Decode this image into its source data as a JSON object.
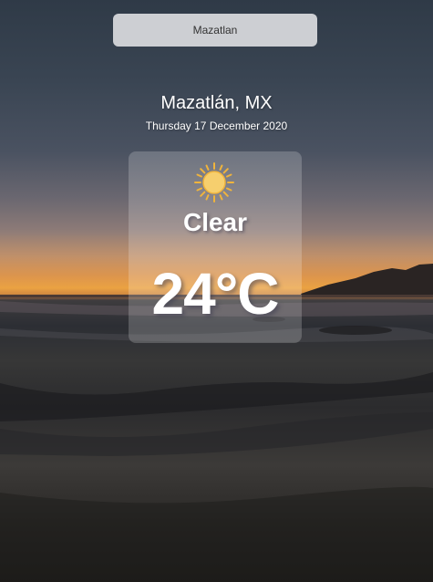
{
  "search": {
    "value": "Mazatlan",
    "placeholder": ""
  },
  "location": {
    "label": "Mazatlán, MX"
  },
  "date": {
    "label": "Thursday 17 December 2020"
  },
  "weather": {
    "icon": "sun-icon",
    "condition": "Clear",
    "temperature": "24°C"
  },
  "colors": {
    "search_bg": "#cdcfd3",
    "text": "#ffffff",
    "sun_core": "#f6cf6e",
    "sun_rays": "#f0b43c"
  }
}
